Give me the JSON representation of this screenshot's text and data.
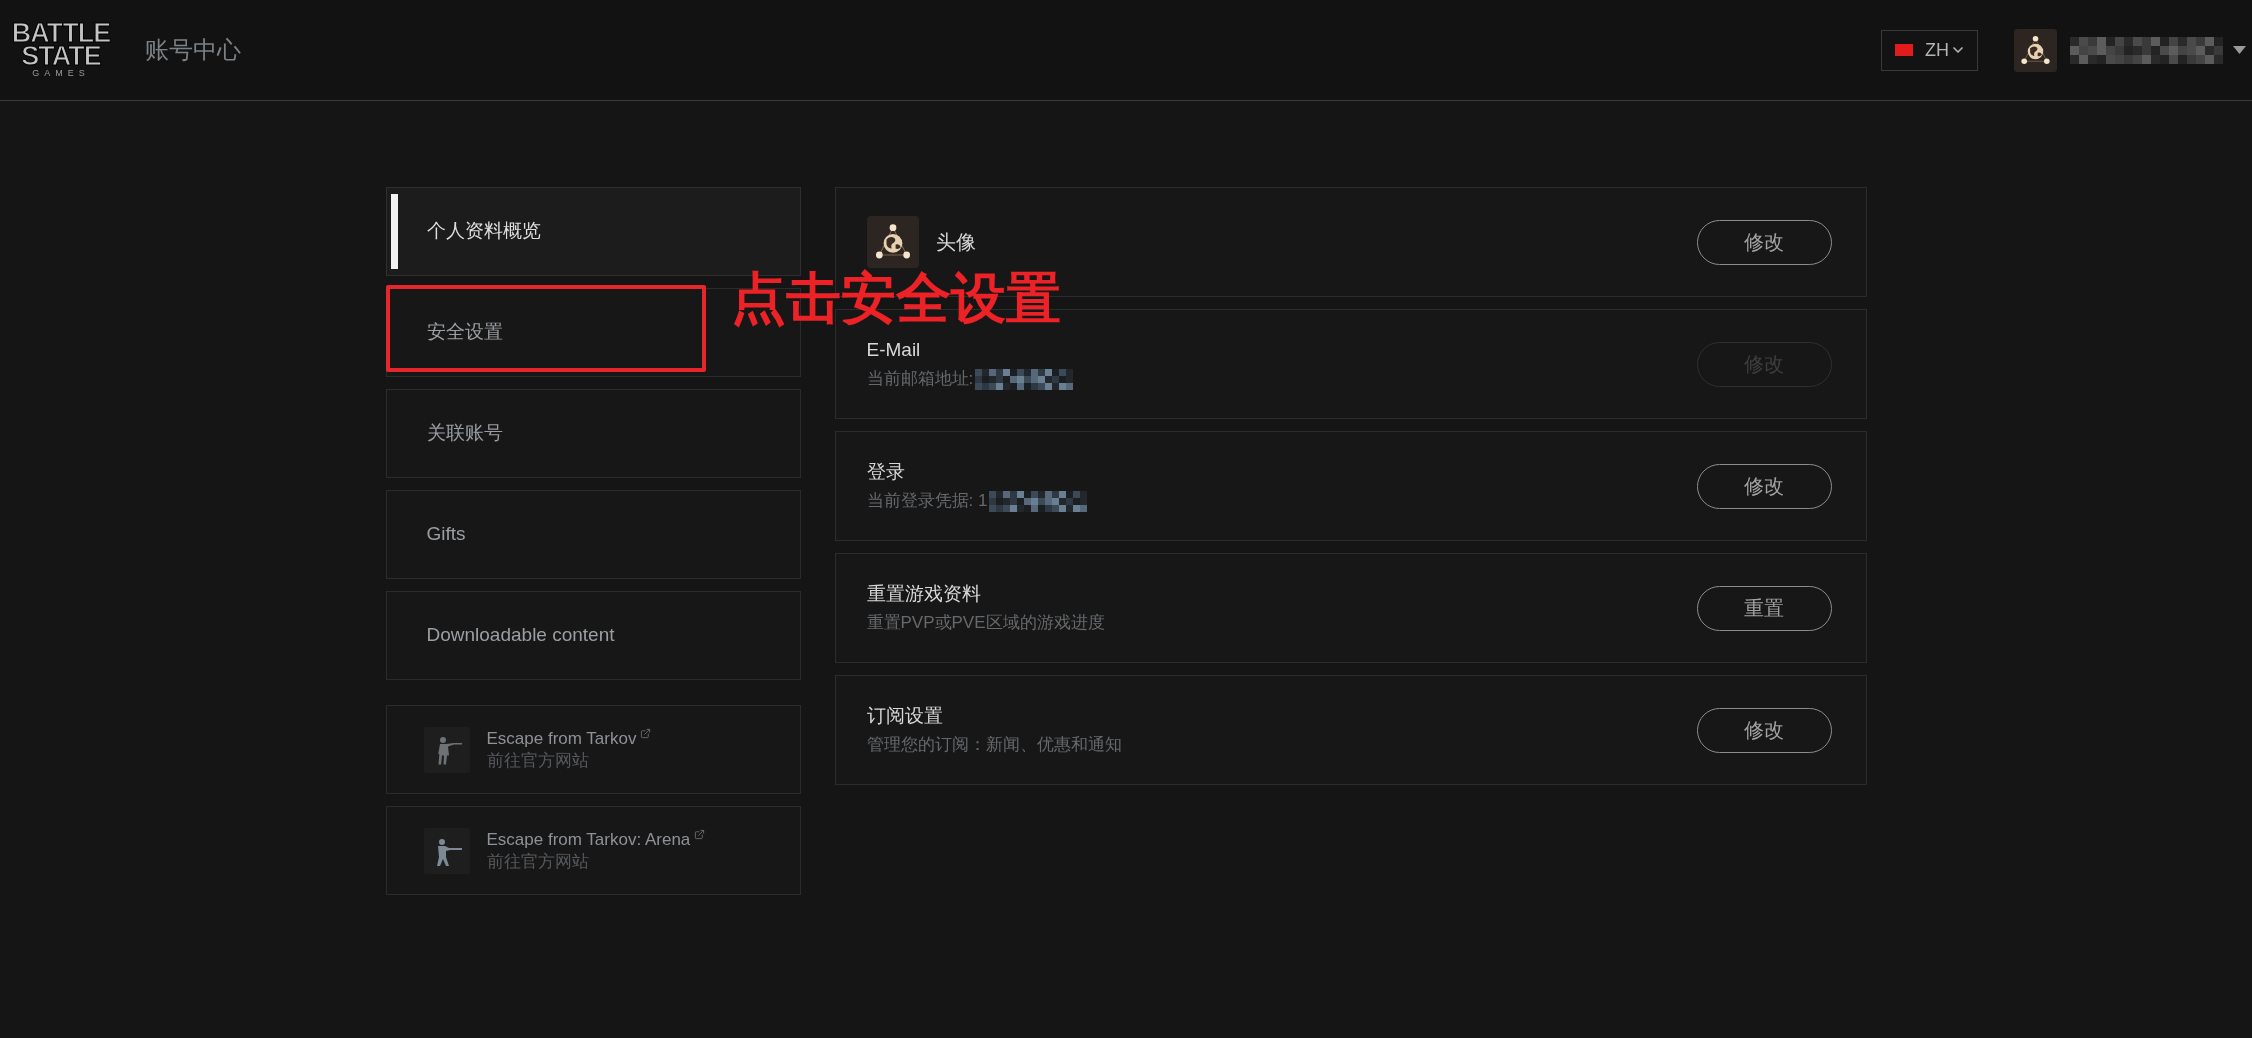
{
  "header": {
    "logo": {
      "lines": [
        "BATTLE",
        "STATE",
        "GAMES"
      ]
    },
    "title": "账号中心",
    "language": {
      "code": "ZH"
    },
    "user": {
      "name_hidden": true
    }
  },
  "sidebar": {
    "items": [
      {
        "label": "个人资料概览",
        "selected": true
      },
      {
        "label": "安全设置",
        "selected": false,
        "annotation": "点击安全设置"
      },
      {
        "label": "关联账号",
        "selected": false
      },
      {
        "label": "Gifts",
        "selected": false
      },
      {
        "label": "Downloadable content",
        "selected": false
      }
    ],
    "game_links": [
      {
        "title": "Escape from Tarkov",
        "subtitle": "前往官方网站"
      },
      {
        "title": "Escape from Tarkov: Arena",
        "subtitle": "前往官方网站"
      }
    ]
  },
  "sections": [
    {
      "kind": "avatar",
      "title": "头像",
      "button": {
        "label": "修改",
        "disabled": false
      }
    },
    {
      "kind": "detail",
      "title": "E-Mail",
      "subtitle": "当前邮箱地址:",
      "value_hidden": true,
      "button": {
        "label": "修改",
        "disabled": true
      }
    },
    {
      "kind": "detail",
      "title": "登录",
      "subtitle": "当前登录凭据: 1",
      "value_hidden": true,
      "button": {
        "label": "修改",
        "disabled": false
      }
    },
    {
      "kind": "detail",
      "title": "重置游戏资料",
      "subtitle": "重置PVP或PVE区域的游戏进度",
      "value_hidden": false,
      "button": {
        "label": "重置",
        "disabled": false
      }
    },
    {
      "kind": "detail",
      "title": "订阅设置",
      "subtitle": "管理您的订阅：新闻、优惠和通知",
      "value_hidden": false,
      "button": {
        "label": "修改",
        "disabled": false
      }
    }
  ]
}
